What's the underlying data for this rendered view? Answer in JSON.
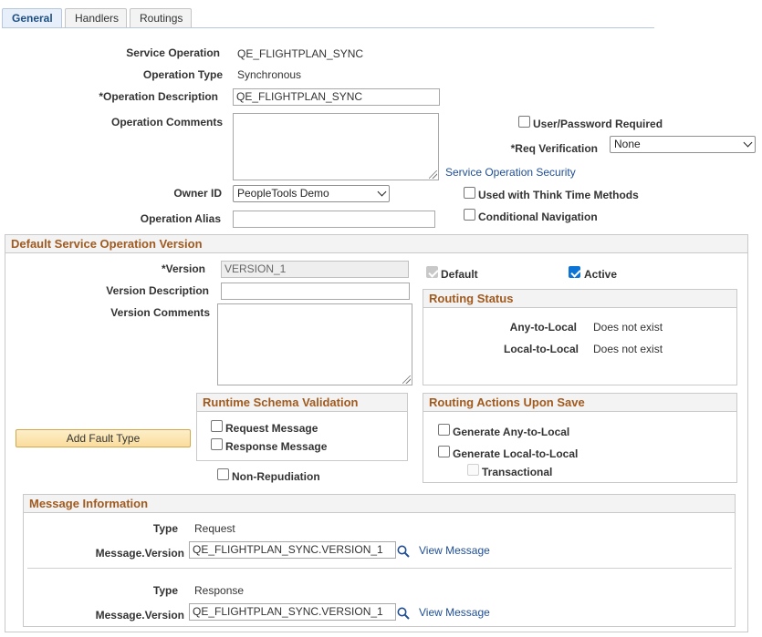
{
  "tabs": [
    {
      "label": "General",
      "active": true
    },
    {
      "label": "Handlers",
      "active": false
    },
    {
      "label": "Routings",
      "active": false
    }
  ],
  "service_operation": {
    "label": "Service Operation",
    "value": "QE_FLIGHTPLAN_SYNC"
  },
  "operation_type": {
    "label": "Operation Type",
    "value": "Synchronous"
  },
  "operation_description": {
    "label": "*Operation Description",
    "value": "QE_FLIGHTPLAN_SYNC"
  },
  "operation_comments": {
    "label": "Operation Comments",
    "value": ""
  },
  "user_password_required": {
    "label": "User/Password Required",
    "checked": false
  },
  "req_verification": {
    "label": "*Req Verification",
    "value": "None"
  },
  "service_operation_security_link": "Service Operation Security",
  "owner_id": {
    "label": "Owner ID",
    "value": "PeopleTools Demo"
  },
  "think_time": {
    "label": "Used with Think Time Methods",
    "checked": false
  },
  "operation_alias": {
    "label": "Operation Alias",
    "value": ""
  },
  "conditional_navigation": {
    "label": "Conditional Navigation",
    "checked": false
  },
  "default_version_section": {
    "title": "Default Service Operation Version",
    "version": {
      "label": "*Version",
      "value": "VERSION_1"
    },
    "default_checkbox": {
      "label": "Default",
      "checked": true
    },
    "active_checkbox": {
      "label": "Active",
      "checked": true
    },
    "version_description": {
      "label": "Version Description",
      "value": ""
    },
    "version_comments": {
      "label": "Version Comments",
      "value": ""
    },
    "routing_status": {
      "title": "Routing Status",
      "any_to_local": {
        "label": "Any-to-Local",
        "value": "Does not exist"
      },
      "local_to_local": {
        "label": "Local-to-Local",
        "value": "Does not exist"
      }
    },
    "runtime_schema_validation": {
      "title": "Runtime Schema Validation",
      "request_message": {
        "label": "Request Message",
        "checked": false
      },
      "response_message": {
        "label": "Response Message",
        "checked": false
      }
    },
    "routing_actions": {
      "title": "Routing Actions Upon Save",
      "generate_any_to_local": {
        "label": "Generate Any-to-Local",
        "checked": false
      },
      "generate_local_to_local": {
        "label": "Generate Local-to-Local",
        "checked": false
      },
      "transactional": {
        "label": "Transactional",
        "checked": false
      }
    },
    "add_fault_type_button": "Add Fault Type",
    "non_repudiation": {
      "label": "Non-Repudiation",
      "checked": false
    }
  },
  "message_information": {
    "title": "Message Information",
    "type_label": "Type",
    "message_version_label": "Message.Version",
    "view_message_link": "View Message",
    "rows": [
      {
        "type": "Request",
        "message_version": "QE_FLIGHTPLAN_SYNC.VERSION_1"
      },
      {
        "type": "Response",
        "message_version": "QE_FLIGHTPLAN_SYNC.VERSION_1"
      }
    ]
  },
  "colors": {
    "section_header_text": "#a15a1e",
    "link": "#1f4e95",
    "checkbox_checked": "#0b74d6",
    "button_fill": "#fbdd9c",
    "active_tab_bg": "#e7f0fa"
  },
  "icons": {
    "lookup": "magnifier-icon",
    "textarea_resize": "resize-grip-icon",
    "dropdown": "chevron-down-icon"
  }
}
